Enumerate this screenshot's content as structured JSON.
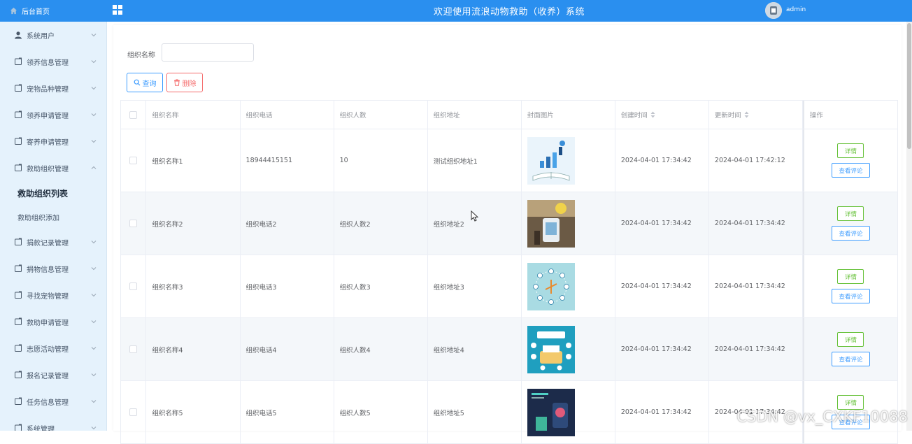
{
  "header": {
    "title": "欢迎使用流浪动物救助（收养）系统",
    "user": "admin"
  },
  "sidebar": {
    "home": "后台首页",
    "items": [
      {
        "label": "系统用户",
        "icon": "user-icon"
      },
      {
        "label": "领养信息管理",
        "icon": "folder-icon"
      },
      {
        "label": "宠物品种管理",
        "icon": "folder-icon"
      },
      {
        "label": "领养申请管理",
        "icon": "folder-icon"
      },
      {
        "label": "寄养申请管理",
        "icon": "folder-icon"
      },
      {
        "label": "救助组织管理",
        "icon": "folder-icon",
        "expanded": true
      },
      {
        "label": "捐款记录管理",
        "icon": "folder-icon"
      },
      {
        "label": "捐物信息管理",
        "icon": "folder-icon"
      },
      {
        "label": "寻找宠物管理",
        "icon": "folder-icon"
      },
      {
        "label": "救助申请管理",
        "icon": "folder-icon"
      },
      {
        "label": "志愿活动管理",
        "icon": "folder-icon"
      },
      {
        "label": "报名记录管理",
        "icon": "folder-icon"
      },
      {
        "label": "任务信息管理",
        "icon": "folder-icon"
      },
      {
        "label": "系统管理",
        "icon": "folder-icon"
      }
    ],
    "submenu": [
      {
        "label": "救助组织列表",
        "active": true
      },
      {
        "label": "救助组织添加",
        "active": false
      }
    ]
  },
  "search": {
    "label": "组织名称",
    "value": "",
    "placeholder": ""
  },
  "buttons": {
    "query": "查询",
    "delete": "删除"
  },
  "table": {
    "columns": [
      "组织名称",
      "组织电话",
      "组织人数",
      "组织地址",
      "封面图片",
      "创建时间",
      "更新时间",
      "操作"
    ],
    "rows": [
      {
        "name": "组织名称1",
        "phone": "18944415151",
        "count": "10",
        "address": "测试组织地址1",
        "created": "2024-04-01 17:34:42",
        "updated": "2024-04-01 17:42:12"
      },
      {
        "name": "组织名称2",
        "phone": "组织电话2",
        "count": "组织人数2",
        "address": "组织地址2",
        "created": "2024-04-01 17:34:42",
        "updated": "2024-04-01 17:34:42"
      },
      {
        "name": "组织名称3",
        "phone": "组织电话3",
        "count": "组织人数3",
        "address": "组织地址3",
        "created": "2024-04-01 17:34:42",
        "updated": "2024-04-01 17:34:42"
      },
      {
        "name": "组织名称4",
        "phone": "组织电话4",
        "count": "组织人数4",
        "address": "组织地址4",
        "created": "2024-04-01 17:34:42",
        "updated": "2024-04-01 17:34:42"
      },
      {
        "name": "组织名称5",
        "phone": "组织电话5",
        "count": "组织人数5",
        "address": "组织地址5",
        "created": "2024-04-01 17:34:42",
        "updated": "2024-04-01 17:34:42"
      }
    ],
    "actions": {
      "detail": "详情",
      "comments": "查看评论"
    }
  },
  "watermark": "CSDN @vx_CXKF10088",
  "colors": {
    "primary": "#2a8fef",
    "sidebar_bg": "#e5f2fc",
    "success": "#67c23a",
    "danger": "#f56c6c",
    "info": "#409eff"
  }
}
